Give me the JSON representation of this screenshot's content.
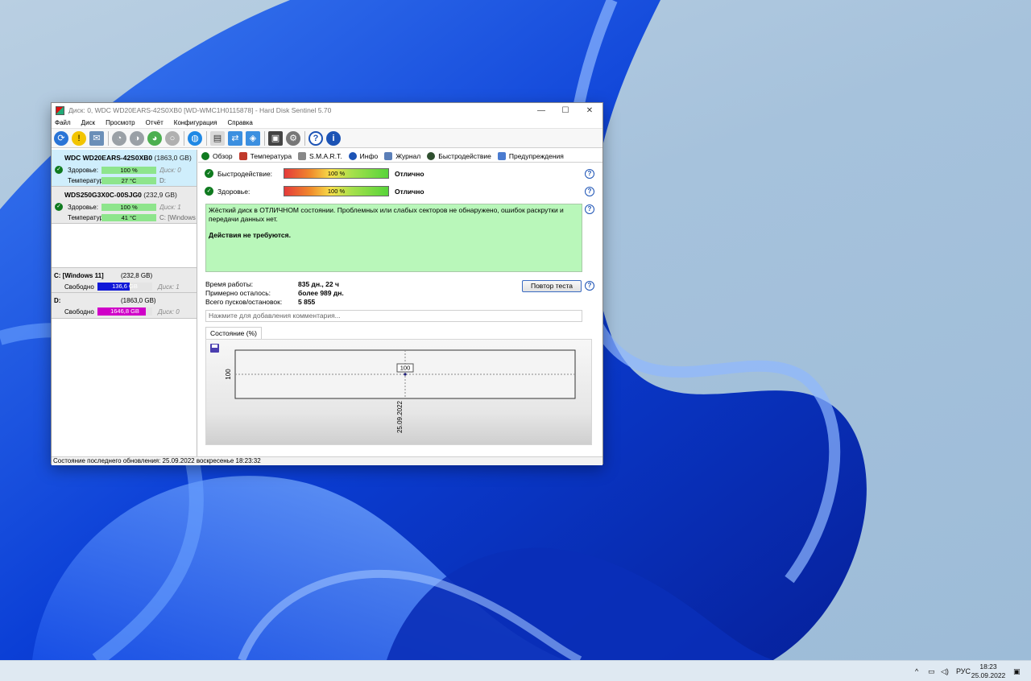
{
  "window": {
    "title": "Диск: 0, WDC WD20EARS-42S0XB0 [WD-WMC1H0115878]  -  Hard Disk Sentinel 5.70",
    "minimize_glyph": "—",
    "maximize_glyph": "☐",
    "close_glyph": "✕"
  },
  "menu": [
    "Файл",
    "Диск",
    "Просмотр",
    "Отчёт",
    "Конфигурация",
    "Справка"
  ],
  "disks": [
    {
      "name": "WDC WD20EARS-42S0XB0",
      "size": "(1863,0 GB)",
      "health_label": "Здоровье:",
      "health_value": "100 %",
      "health_note": "Диск: 0",
      "temp_label": "Температура:",
      "temp_value": "27 °C",
      "temp_note": "D:"
    },
    {
      "name": "WDS250G3X0C-00SJG0",
      "size": "(232,9 GB)",
      "health_label": "Здоровье:",
      "health_value": "100 %",
      "health_note": "Диск: 1",
      "temp_label": "Температура:",
      "temp_value": "41 °C",
      "temp_note": "C: [Windows"
    }
  ],
  "volumes": [
    {
      "name": "C: [Windows 11]",
      "size": "(232,8 GB)",
      "free_label": "Свободно",
      "free_value": "136,6 GB",
      "free_fraction": 0.587,
      "note": "Диск: 1"
    },
    {
      "name": "D:",
      "size": "(1863,0 GB)",
      "free_label": "Свободно",
      "free_value": "1646,8 GB",
      "free_fraction": 0.884,
      "note": "Диск: 0"
    }
  ],
  "tabs": [
    "Обзор",
    "Температура",
    "S.M.A.R.T.",
    "Инфо",
    "Журнал",
    "Быстродействие",
    "Предупреждения"
  ],
  "overview": {
    "performance_label": "Быстродействие:",
    "performance_value": "100 %",
    "performance_verdict": "Отлично",
    "health_label": "Здоровье:",
    "health_value": "100 %",
    "health_verdict": "Отлично",
    "status_text": "Жёсткий диск в ОТЛИЧНОМ состоянии. Проблемных или слабых секторов не обнаружено, ошибок раскрутки и передачи данных нет.",
    "status_action": "Действия не требуются.",
    "uptime_label": "Время работы:",
    "uptime_value": "835 дн., 22 ч",
    "remaining_label": "Примерно осталось:",
    "remaining_value": "более 989 дн.",
    "startstop_label": "Всего пусков/остановок:",
    "startstop_value": "5 855",
    "retest_button": "Повтор теста",
    "comment_placeholder": "Нажмите для добавления комментария...",
    "help_glyph": "?"
  },
  "chart_data": {
    "type": "line",
    "tab_label": "Состояние (%)",
    "x": [
      "25.09.2022"
    ],
    "series": [
      {
        "values": [
          100
        ]
      }
    ],
    "ytick_label": "100",
    "point_label": "100",
    "grid": true
  },
  "statusbar": "Состояние последнего обновления: 25.09.2022 воскресенье 18:23:32",
  "taskbar": {
    "lang": "РУС",
    "time": "18:23",
    "date": "25.09.2022",
    "chevron": "^"
  },
  "colors": {
    "accent": "#1c53b5",
    "ok_green": "#0f7a1f",
    "status_bg": "#b9f7ba",
    "free_c": "#1018d8",
    "free_d": "#d000c8"
  }
}
